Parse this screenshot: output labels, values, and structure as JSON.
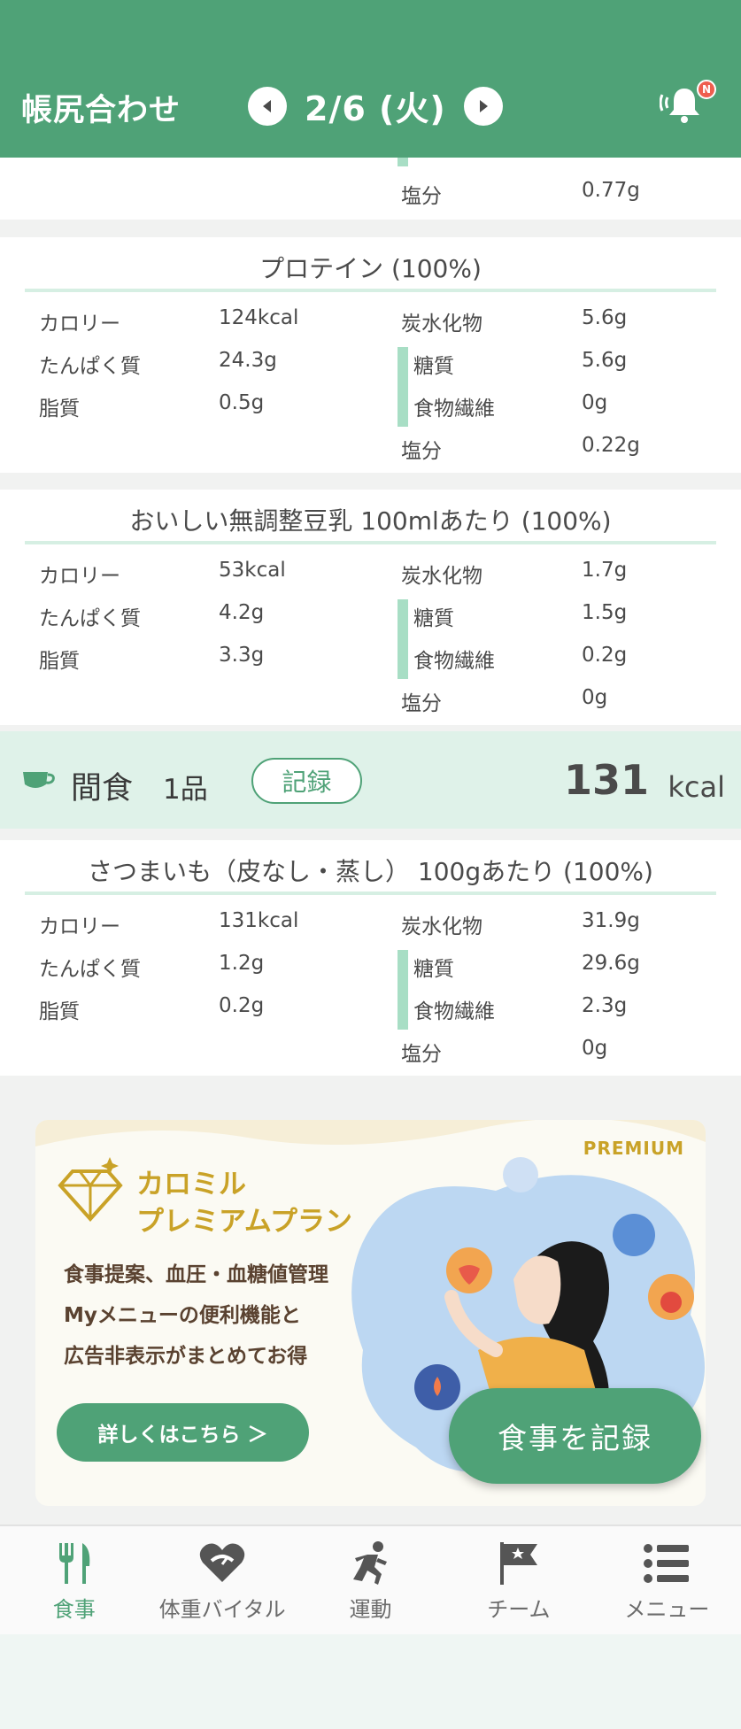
{
  "header": {
    "title": "帳尻合わせ",
    "date": "2/6 (火)",
    "notification_badge": "N"
  },
  "colors": {
    "brand_green": "#4fa277",
    "light_green": "#dff2e9",
    "gold": "#c9a227"
  },
  "top_card": {
    "salt_label": "塩分",
    "salt_value": "0.77g"
  },
  "cards": [
    {
      "title": "プロテイン (100%)",
      "calorie_label": "カロリー",
      "calorie": "124kcal",
      "protein_label": "たんぱく質",
      "protein": "24.3g",
      "fat_label": "脂質",
      "fat": "0.5g",
      "carb_label": "炭水化物",
      "carb": "5.6g",
      "sugar_label": "糖質",
      "sugar": "5.6g",
      "fiber_label": "食物繊維",
      "fiber": "0g",
      "salt_label": "塩分",
      "salt": "0.22g"
    },
    {
      "title": "おいしい無調整豆乳 100mlあたり (100%)",
      "calorie_label": "カロリー",
      "calorie": "53kcal",
      "protein_label": "たんぱく質",
      "protein": "4.2g",
      "fat_label": "脂質",
      "fat": "3.3g",
      "carb_label": "炭水化物",
      "carb": "1.7g",
      "sugar_label": "糖質",
      "sugar": "1.5g",
      "fiber_label": "食物繊維",
      "fiber": "0.2g",
      "salt_label": "塩分",
      "salt": "0g"
    },
    {
      "title": "さつまいも（皮なし・蒸し） 100gあたり (100%)",
      "calorie_label": "カロリー",
      "calorie": "131kcal",
      "protein_label": "たんぱく質",
      "protein": "1.2g",
      "fat_label": "脂質",
      "fat": "0.2g",
      "carb_label": "炭水化物",
      "carb": "31.9g",
      "sugar_label": "糖質",
      "sugar": "29.6g",
      "fiber_label": "食物繊維",
      "fiber": "2.3g",
      "salt_label": "塩分",
      "salt": "0g"
    }
  ],
  "snack": {
    "label": "間食",
    "count": "1品",
    "record_button": "記録",
    "kcal": "131",
    "kcal_unit": "kcal"
  },
  "banner": {
    "tag": "PREMIUM",
    "brand_line1": "カロミル",
    "brand_line2": "プレミアムプラン",
    "desc_line1": "食事提案、血圧・血糖値管理",
    "desc_line2": "Myメニューの便利機能と",
    "desc_line3": "広告非表示がまとめてお得",
    "detail_button": "詳しくはこちら ＞"
  },
  "fab": {
    "label": "食事を記録"
  },
  "nav": [
    {
      "label": "食事",
      "icon": "fork-knife-icon",
      "active": true
    },
    {
      "label": "体重バイタル",
      "icon": "heart-scale-icon",
      "active": false
    },
    {
      "label": "運動",
      "icon": "runner-icon",
      "active": false
    },
    {
      "label": "チーム",
      "icon": "flag-star-icon",
      "active": false
    },
    {
      "label": "メニュー",
      "icon": "list-icon",
      "active": false
    }
  ]
}
